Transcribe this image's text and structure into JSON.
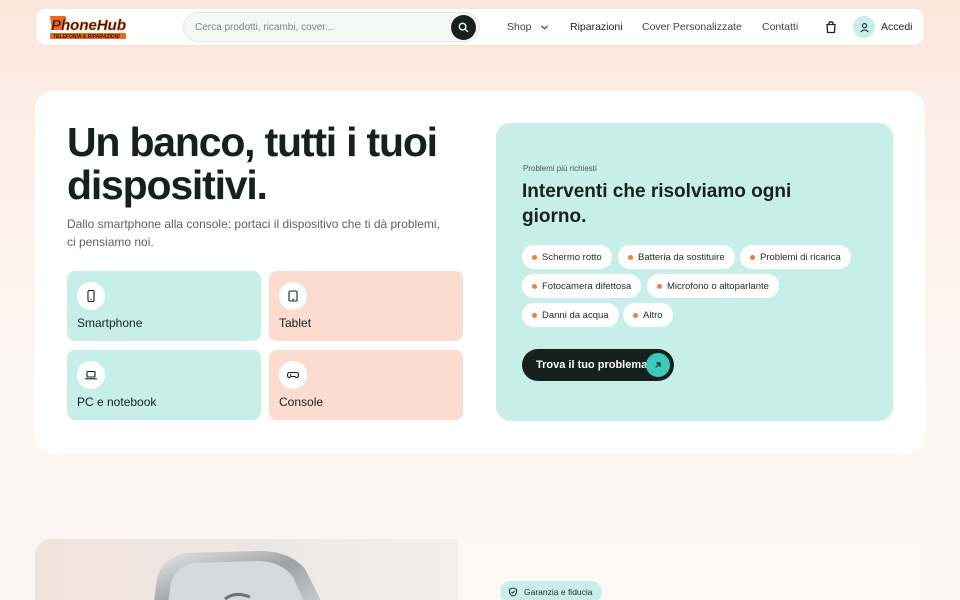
{
  "brand": {
    "logo_text": "PhoneHub",
    "logo_tagline": "TELEFONIA & RIPARAZIONI",
    "colors": {
      "accent_teal": "#c8eeea",
      "accent_peach": "#fcdccf",
      "dark": "#16211e",
      "dot_orange": "#ef7e3f",
      "logo_orange": "#f06a1d"
    }
  },
  "header": {
    "search_placeholder": "Cerca prodotti, ricambi, cover...",
    "search_icon": "search-icon",
    "nav": [
      {
        "label": "Shop",
        "icon": "chevron-down-icon"
      },
      {
        "label": "Riparazioni"
      },
      {
        "label": "Cover Personalizzate"
      },
      {
        "label": "Contatti"
      }
    ],
    "cart_icon": "bag-icon",
    "user_icon": "user-icon",
    "login_label": "Accedi"
  },
  "hero": {
    "title": "Un banco, tutti i tuoi dispositivi.",
    "subtitle": "Dallo smartphone alla console: portaci il dispositivo che ti dà problemi, ci pensiamo noi.",
    "categories": [
      {
        "label": "Smartphone",
        "icon": "smartphone-icon",
        "color": "teal"
      },
      {
        "label": "Tablet",
        "icon": "tablet-icon",
        "color": "peach"
      },
      {
        "label": "PC e notebook",
        "icon": "laptop-icon",
        "color": "teal"
      },
      {
        "label": "Console",
        "icon": "gamepad-icon",
        "color": "peach"
      }
    ]
  },
  "problems": {
    "kicker": "Problemi più richiesti",
    "title": "Interventi che risolviamo ogni giorno.",
    "chips": [
      "Schermo rotto",
      "Batteria da sostituire",
      "Problemi di ricarica",
      "Fotocamera difettosa",
      "Microfono o altoparlante",
      "Danni da acqua",
      "Altro"
    ],
    "cta_label": "Trova il tuo problema",
    "cta_icon": "arrow-up-right-icon"
  },
  "trust": {
    "badge_label": "Garanzia e fiducia",
    "badge_icon": "shield-check-icon"
  }
}
